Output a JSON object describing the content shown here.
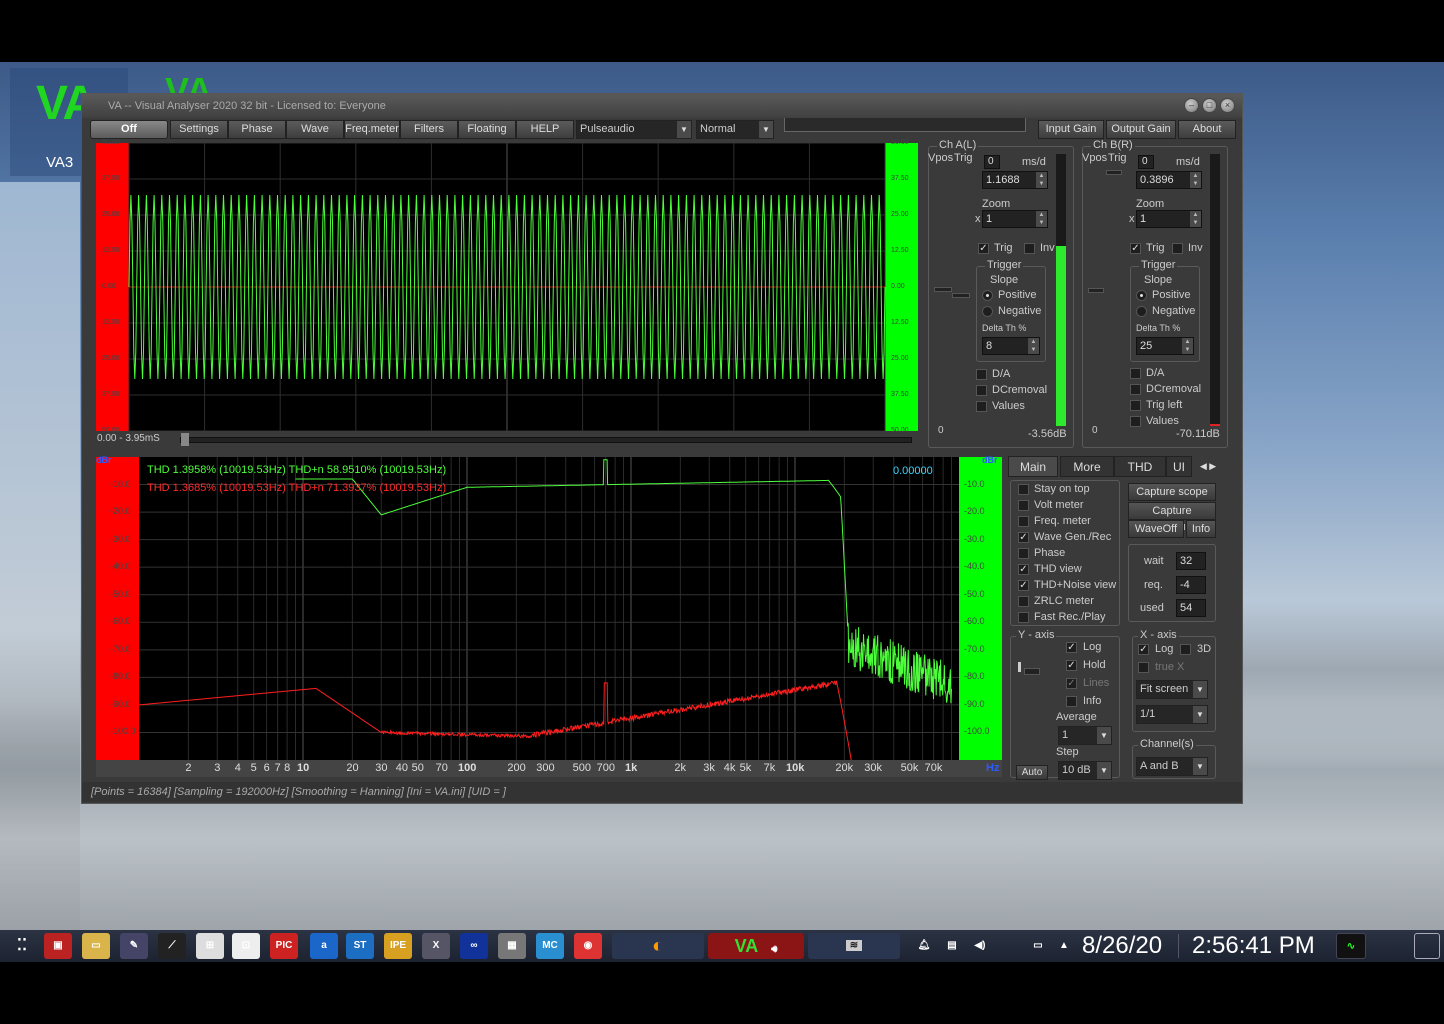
{
  "desktop": {
    "icon_label": "VA3",
    "icon_logo": "VA"
  },
  "window": {
    "title": "VA -- Visual Analyser 2020 32 bit - Licensed to: Everyone"
  },
  "toolbar": {
    "off": "Off",
    "settings": "Settings",
    "phase": "Phase",
    "wave": "Wave",
    "freqmeter": "Freq.meter",
    "filters": "Filters",
    "floating": "Floating",
    "help": "HELP",
    "audio_device": "Pulseaudio",
    "mode": "Normal",
    "input_gain": "Input Gain",
    "output_gain": "Output Gain",
    "about": "About"
  },
  "scope": {
    "time_range": "0.00 - 3.95mS",
    "y_labels": [
      "50.00",
      "37.50",
      "25.00",
      "12.50",
      "0.00",
      "12.50",
      "25.00",
      "37.50",
      "50.00"
    ],
    "colors": {
      "left_bar": "#ff0000",
      "right_bar": "#00ff00",
      "trace": "#4cff3a"
    }
  },
  "chA": {
    "title": "Ch A(L)",
    "vpos": "Vpos",
    "trig_label": "Trig",
    "ms_d": "ms/d",
    "vpos_val": "0",
    "ms_val": "1.1688",
    "zoom_label": "Zoom",
    "zoom_x": "x",
    "zoom_val": "1",
    "trig": "Trig",
    "inv": "Inv",
    "trigger": "Trigger",
    "slope": "Slope",
    "positive": "Positive",
    "negative": "Negative",
    "delta": "Delta Th %",
    "delta_val": "8",
    "da": "D/A",
    "dcremoval": "DCremoval",
    "values": "Values",
    "zero": "0",
    "level": "-3.56dB"
  },
  "chB": {
    "title": "Ch B(R)",
    "vpos": "Vpos",
    "trig_label": "Trig",
    "ms_d": "ms/d",
    "vpos_val": "0",
    "ms_val": "0.3896",
    "zoom_label": "Zoom",
    "zoom_x": "x",
    "zoom_val": "1",
    "trig": "Trig",
    "inv": "Inv",
    "trigger": "Trigger",
    "slope": "Slope",
    "positive": "Positive",
    "negative": "Negative",
    "delta": "Delta Th %",
    "delta_val": "25",
    "da": "D/A",
    "dcremoval": "DCremoval",
    "trigleft": "Trig left",
    "values": "Values",
    "zero": "0",
    "level": "-70.11dB"
  },
  "spectrum": {
    "dbr": "dBr",
    "thd_green": "THD 1.3958% (10019.53Hz) THD+n 58.9510% (10019.53Hz)",
    "thd_red": "THD 1.3685% (10019.53Hz) THD+n 71.3937% (10019.53Hz)",
    "readout": "0.00000",
    "y_labels": [
      "-10.0",
      "-20.0",
      "-30.0",
      "-40.0",
      "-50.0",
      "-60.0",
      "-70.0",
      "-80.0",
      "-90.0",
      "-100.0"
    ],
    "x_labels": [
      {
        "t": "2",
        "b": false
      },
      {
        "t": "3",
        "b": false
      },
      {
        "t": "4",
        "b": false
      },
      {
        "t": "5",
        "b": false
      },
      {
        "t": "6",
        "b": false
      },
      {
        "t": "7",
        "b": false
      },
      {
        "t": "8",
        "b": false
      },
      {
        "t": "10",
        "b": true
      },
      {
        "t": "20",
        "b": false
      },
      {
        "t": "30",
        "b": false
      },
      {
        "t": "40",
        "b": false
      },
      {
        "t": "50",
        "b": false
      },
      {
        "t": "70",
        "b": false
      },
      {
        "t": "100",
        "b": true
      },
      {
        "t": "200",
        "b": false
      },
      {
        "t": "300",
        "b": false
      },
      {
        "t": "500",
        "b": false
      },
      {
        "t": "700",
        "b": false
      },
      {
        "t": "1k",
        "b": true
      },
      {
        "t": "2k",
        "b": false
      },
      {
        "t": "3k",
        "b": false
      },
      {
        "t": "4k",
        "b": false
      },
      {
        "t": "5k",
        "b": false
      },
      {
        "t": "7k",
        "b": false
      },
      {
        "t": "10k",
        "b": true
      },
      {
        "t": "20k",
        "b": false
      },
      {
        "t": "30k",
        "b": false
      },
      {
        "t": "50k",
        "b": false
      },
      {
        "t": "70k",
        "b": false
      }
    ],
    "hz": "Hz"
  },
  "tabs": [
    "Main",
    "More",
    "THD",
    "UI"
  ],
  "main": {
    "options": [
      {
        "label": "Stay on top",
        "checked": false
      },
      {
        "label": "Volt meter",
        "checked": false
      },
      {
        "label": "Freq. meter",
        "checked": false
      },
      {
        "label": "Wave Gen./Rec",
        "checked": true
      },
      {
        "label": "Phase",
        "checked": false
      },
      {
        "label": "THD view",
        "checked": true
      },
      {
        "label": "THD+Noise view",
        "checked": true
      },
      {
        "label": "ZRLC meter",
        "checked": false
      },
      {
        "label": "Fast Rec./Play",
        "checked": false
      }
    ],
    "capture_scope": "Capture scope",
    "capture_spectrum": "Capture spectrum",
    "waveoff": "WaveOff",
    "info": "Info",
    "wait": "wait",
    "wait_val": "32",
    "req": "req.",
    "req_val": "-4",
    "used": "used",
    "used_val": "54"
  },
  "yaxis": {
    "title": "Y - axis",
    "log": "Log",
    "hold": "Hold",
    "lines": "Lines",
    "info": "Info",
    "average": "Average",
    "average_val": "1",
    "step": "Step",
    "step_val": "10 dB",
    "auto": "Auto"
  },
  "xaxis_panel": {
    "title": "X - axis",
    "log": "Log",
    "threed": "3D",
    "truex": "true X",
    "fit": "Fit screen",
    "ratio": "1/1",
    "channels": "Channel(s)",
    "channels_val": "A and B"
  },
  "status": "[Points = 16384]  [Sampling = 192000Hz]  [Smoothing = Hanning]  [Ini = VA.ini]  [UID = ]",
  "taskbar": {
    "date": "8/26/20",
    "time": "2:56:41 PM",
    "icons": [
      {
        "name": "apps-menu-icon",
        "t": "⁚⁚",
        "c": "transparent"
      },
      {
        "name": "red-app-icon",
        "t": "▣",
        "c": "#b22"
      },
      {
        "name": "folder-icon",
        "t": "▭",
        "c": "#d9b44a"
      },
      {
        "name": "tools-icon",
        "t": "✎",
        "c": "#446"
      },
      {
        "name": "ltspice-icon",
        "t": "⟋",
        "c": "#222"
      },
      {
        "name": "schematic-icon",
        "t": "⊞",
        "c": "#ddd"
      },
      {
        "name": "logic-icon",
        "t": "⊡",
        "c": "#eee"
      },
      {
        "name": "pickit-icon",
        "t": "PIC",
        "c": "#c22"
      },
      {
        "name": "arduino-a-icon",
        "t": "a",
        "c": "#1b66c9"
      },
      {
        "name": "stlink-icon",
        "t": "ST",
        "c": "#1b6ec2"
      },
      {
        "name": "mplab-ipe-icon",
        "t": "IPE",
        "c": "#d8a020"
      },
      {
        "name": "mplab-x-icon",
        "t": "X",
        "c": "#556"
      },
      {
        "name": "arduino-icon",
        "t": "∞",
        "c": "#139"
      },
      {
        "name": "calculator-icon",
        "t": "▦",
        "c": "#777"
      },
      {
        "name": "mc-icon",
        "t": "MC",
        "c": "#2a8fd0"
      },
      {
        "name": "chrome-icon",
        "t": "◉",
        "c": "#d33"
      }
    ],
    "va_task": "VA"
  }
}
